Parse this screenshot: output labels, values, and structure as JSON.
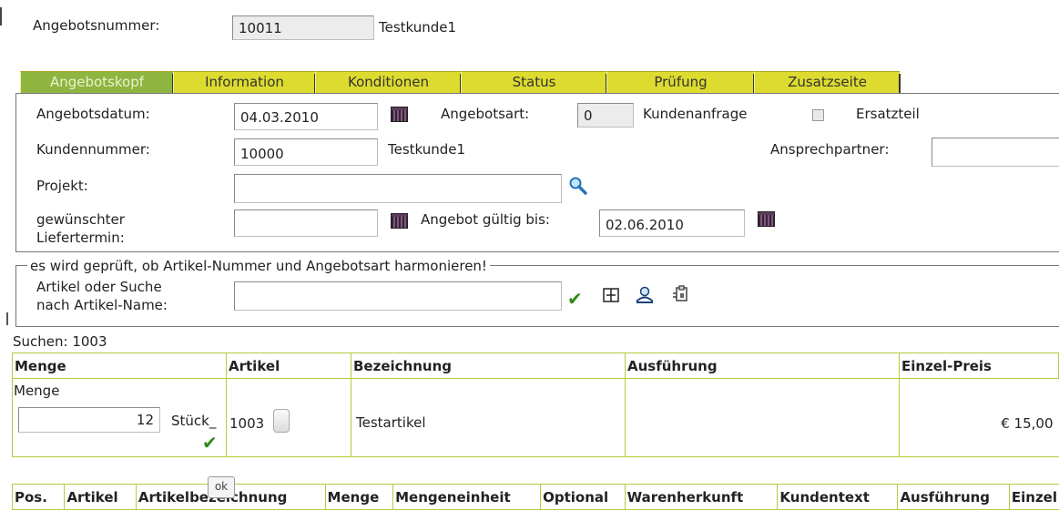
{
  "header": {
    "offer_number_label": "Angebotsnummer:",
    "offer_number_value": "10011",
    "customer_name": "Testkunde1"
  },
  "tabs": [
    {
      "label": "Angebotskopf",
      "active": true
    },
    {
      "label": "Information",
      "active": false
    },
    {
      "label": "Konditionen",
      "active": false
    },
    {
      "label": "Status",
      "active": false
    },
    {
      "label": "Prüfung",
      "active": false
    },
    {
      "label": "Zusatzseite",
      "active": false
    }
  ],
  "form": {
    "offer_date_label": "Angebotsdatum:",
    "offer_date_value": "04.03.2010",
    "offer_type_label": "Angebotsart:",
    "offer_type_value": "0",
    "offer_type_text": "Kundenanfrage",
    "spare_part_label": "Ersatzteil",
    "customer_number_label": "Kundennummer:",
    "customer_number_value": "10000",
    "customer_number_name": "Testkunde1",
    "contact_label": "Ansprechpartner:",
    "contact_value": "",
    "project_label": "Projekt:",
    "project_value": "",
    "delivery_label_line1": "gewünschter",
    "delivery_label_line2": "Liefertermin:",
    "delivery_value": "",
    "valid_until_label": "Angebot gültig bis:",
    "valid_until_value": "02.06.2010"
  },
  "article_search": {
    "legend": "es wird geprüft, ob Artikel-Nummer und Angebotsart harmonieren!",
    "label_line1": "Artikel oder Suche",
    "label_line2": "nach Artikel-Name:",
    "value": ""
  },
  "search_result": {
    "caption": "Suchen: 1003",
    "columns": [
      "Menge",
      "Artikel",
      "Bezeichnung",
      "Ausführung",
      "Einzel-Preis"
    ],
    "row": {
      "menge_label": "Menge",
      "menge_value": "12",
      "unit": "Stück_",
      "artikel": "1003",
      "bezeichnung": "Testartikel",
      "ausfuehrung": "",
      "einzelpreis": "€ 15,00"
    }
  },
  "positions_table": {
    "columns": [
      "Pos.",
      "Artikel",
      "Artikelbezeichnung",
      "Menge",
      "Mengeneinheit",
      "Optional",
      "Warenherkunft",
      "Kundentext",
      "Ausführung",
      "Einzel"
    ]
  },
  "ok_button": "ok",
  "colors": {
    "tab_bg": "#dddb2f",
    "tab_active_bg": "#8eb53f",
    "grid_border": "#b9c93b",
    "check_green": "#2e8a1b"
  }
}
